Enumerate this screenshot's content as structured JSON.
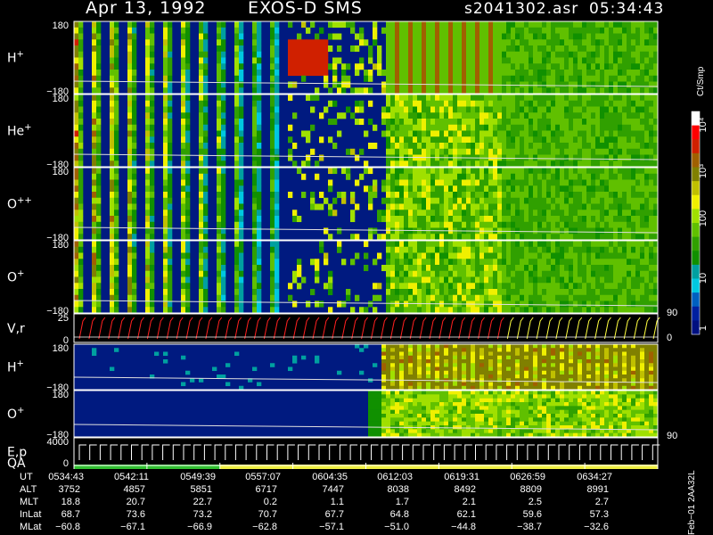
{
  "header": {
    "date": "Apr 13, 1992",
    "instrument": "EXOS-D SMS",
    "filename": "s2041302.asr",
    "time": "05:34:43"
  },
  "colorbar": {
    "units": "Ct/Smp",
    "tick_labels": [
      "10⁴",
      "10³",
      "100",
      "10",
      "1"
    ],
    "colors": [
      "#ffffff",
      "#ff0000",
      "#d02000",
      "#a06000",
      "#808000",
      "#c0c000",
      "#f0f000",
      "#a0e000",
      "#60c000",
      "#30a000",
      "#109000",
      "#00a0a0",
      "#00c8e0",
      "#0060c0",
      "#0020a0",
      "#001080"
    ]
  },
  "panels": [
    {
      "id": "h-plus-1",
      "label": "H",
      "sup": "+",
      "ymax": "180",
      "ymin": "−180"
    },
    {
      "id": "he-plus",
      "label": "He",
      "sup": "+",
      "ymax": "180",
      "ymin": "−180"
    },
    {
      "id": "o-plusplus",
      "label": "O",
      "sup": "++",
      "ymax": "180",
      "ymin": "−180"
    },
    {
      "id": "o-plus-1",
      "label": "O",
      "sup": "+",
      "ymax": "180",
      "ymin": "−180"
    },
    {
      "id": "v-r",
      "label": "V,r",
      "sup": "",
      "ymax": "25",
      "ymin": "0",
      "right_max": "90",
      "right_min": "0"
    },
    {
      "id": "h-plus-2",
      "label": "H",
      "sup": "+",
      "ymax": "180",
      "ymin": "−180"
    },
    {
      "id": "o-plus-2",
      "label": "O",
      "sup": "+",
      "ymax": "180",
      "ymin": "−180",
      "right_val": "90"
    },
    {
      "id": "e-p",
      "label": "E,p",
      "sup": "",
      "ymax": "4000",
      "ymin": "0"
    }
  ],
  "qa_label": "QA",
  "orbit": {
    "labels": [
      "UT",
      "ALT",
      "MLT",
      "InLat",
      "MLat"
    ],
    "columns": [
      [
        "0534:43",
        "3752",
        "18.8",
        "68.7",
        "−60.8"
      ],
      [
        "0542:11",
        "4857",
        "20.7",
        "73.6",
        "−67.1"
      ],
      [
        "0549:39",
        "5851",
        "22.7",
        "73.2",
        "−66.9"
      ],
      [
        "0557:07",
        "6717",
        "0.2",
        "70.7",
        "−62.8"
      ],
      [
        "0604:35",
        "7447",
        "1.1",
        "67.7",
        "−57.1"
      ],
      [
        "0612:03",
        "8038",
        "1.7",
        "64.8",
        "−51.0"
      ],
      [
        "0619:31",
        "8492",
        "2.1",
        "62.1",
        "−44.8"
      ],
      [
        "0626:59",
        "8809",
        "2.5",
        "59.6",
        "−38.7"
      ],
      [
        "0634:27",
        "8991",
        "2.7",
        "57.3",
        "−32.6"
      ]
    ]
  },
  "footer": "Feb−01  2AA32L",
  "chart_data": {
    "type": "heatmap",
    "title": "Apr 13, 1992  EXOS-D SMS",
    "x_ticks": [
      "0534:43",
      "0542:11",
      "0549:39",
      "0557:07",
      "0604:35",
      "0612:03",
      "0619:31",
      "0626:59",
      "0634:27"
    ],
    "series": [
      {
        "name": "H+",
        "ylim": [
          -180,
          180
        ]
      },
      {
        "name": "He+",
        "ylim": [
          -180,
          180
        ]
      },
      {
        "name": "O++",
        "ylim": [
          -180,
          180
        ]
      },
      {
        "name": "O+",
        "ylim": [
          -180,
          180
        ]
      },
      {
        "name": "V,r",
        "ylim": [
          0,
          25
        ]
      },
      {
        "name": "H+",
        "ylim": [
          -180,
          180
        ]
      },
      {
        "name": "O+",
        "ylim": [
          -180,
          180
        ]
      },
      {
        "name": "E,p",
        "ylim": [
          0,
          4000
        ]
      }
    ],
    "color_scale": {
      "type": "log",
      "units": "Ct/Smp",
      "range": [
        1,
        10000
      ]
    }
  }
}
